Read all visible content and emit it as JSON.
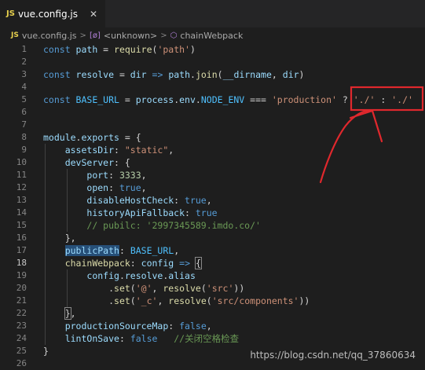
{
  "tab": {
    "badge": "JS",
    "filename": "vue.config.js",
    "close_glyph": "✕"
  },
  "breadcrumb": {
    "file_badge": "JS",
    "file": "vue.config.js",
    "sep1": ">",
    "unknown_icon": "[ø]",
    "unknown": "<unknown>",
    "sep2": ">",
    "symbol_icon": "⬡",
    "symbol": "chainWebpack"
  },
  "editor": {
    "active_line": 18,
    "lines": [
      {
        "n": "1",
        "t": [
          [
            "kw",
            "const "
          ],
          [
            "vr",
            "path"
          ],
          [
            "pl",
            " = "
          ],
          [
            "fn",
            "require"
          ],
          [
            "pl",
            "("
          ],
          [
            "st",
            "'path'"
          ],
          [
            "pl",
            ")"
          ]
        ]
      },
      {
        "n": "2",
        "t": []
      },
      {
        "n": "3",
        "t": [
          [
            "kw",
            "const "
          ],
          [
            "vr",
            "resolve"
          ],
          [
            "pl",
            " = "
          ],
          [
            "vr",
            "dir"
          ],
          [
            "pl",
            " "
          ],
          [
            "kw",
            "=>"
          ],
          [
            "pl",
            " "
          ],
          [
            "vr",
            "path"
          ],
          [
            "pl",
            "."
          ],
          [
            "fn",
            "join"
          ],
          [
            "pl",
            "("
          ],
          [
            "vr",
            "__dirname"
          ],
          [
            "pl",
            ", "
          ],
          [
            "vr",
            "dir"
          ],
          [
            "pl",
            ")"
          ]
        ]
      },
      {
        "n": "4",
        "t": []
      },
      {
        "n": "5",
        "t": [
          [
            "kw",
            "const "
          ],
          [
            "cn",
            "BASE_URL"
          ],
          [
            "pl",
            " = "
          ],
          [
            "vr",
            "process"
          ],
          [
            "pl",
            "."
          ],
          [
            "vr",
            "env"
          ],
          [
            "pl",
            "."
          ],
          [
            "cn",
            "NODE_ENV"
          ],
          [
            "pl",
            " === "
          ],
          [
            "st",
            "'production'"
          ],
          [
            "pl",
            " ? "
          ],
          [
            "st",
            "'./'"
          ],
          [
            "pl",
            " : "
          ],
          [
            "st",
            "'./'"
          ]
        ]
      },
      {
        "n": "6",
        "t": []
      },
      {
        "n": "7",
        "t": []
      },
      {
        "n": "8",
        "t": [
          [
            "vr",
            "module"
          ],
          [
            "pl",
            "."
          ],
          [
            "vr",
            "exports"
          ],
          [
            "pl",
            " = {"
          ]
        ]
      },
      {
        "n": "9",
        "t": [
          [
            "pl",
            "    "
          ],
          [
            "vr",
            "assetsDir"
          ],
          [
            "pl",
            ": "
          ],
          [
            "st",
            "\"static\""
          ],
          [
            "pl",
            ","
          ]
        ]
      },
      {
        "n": "10",
        "t": [
          [
            "pl",
            "    "
          ],
          [
            "vr",
            "devServer"
          ],
          [
            "pl",
            ": {"
          ]
        ]
      },
      {
        "n": "11",
        "t": [
          [
            "pl",
            "        "
          ],
          [
            "vr",
            "port"
          ],
          [
            "pl",
            ": "
          ],
          [
            "nm",
            "3333"
          ],
          [
            "pl",
            ","
          ]
        ]
      },
      {
        "n": "12",
        "t": [
          [
            "pl",
            "        "
          ],
          [
            "vr",
            "open"
          ],
          [
            "pl",
            ": "
          ],
          [
            "kw",
            "true"
          ],
          [
            "pl",
            ","
          ]
        ]
      },
      {
        "n": "13",
        "t": [
          [
            "pl",
            "        "
          ],
          [
            "vr",
            "disableHostCheck"
          ],
          [
            "pl",
            ": "
          ],
          [
            "kw",
            "true"
          ],
          [
            "pl",
            ","
          ]
        ]
      },
      {
        "n": "14",
        "t": [
          [
            "pl",
            "        "
          ],
          [
            "vr",
            "historyApiFallback"
          ],
          [
            "pl",
            ": "
          ],
          [
            "kw",
            "true"
          ]
        ]
      },
      {
        "n": "15",
        "t": [
          [
            "pl",
            "        "
          ],
          [
            "cm",
            "// pubilc: '2997345589.imdo.co/'"
          ]
        ]
      },
      {
        "n": "16",
        "t": [
          [
            "pl",
            "    },"
          ]
        ]
      },
      {
        "n": "17",
        "t": [
          [
            "pl",
            "    "
          ],
          [
            "vr hl",
            "publicPath"
          ],
          [
            "pl",
            ": "
          ],
          [
            "cn",
            "BASE_URL"
          ],
          [
            "pl",
            ","
          ]
        ]
      },
      {
        "n": "18",
        "t": [
          [
            "pl",
            "    "
          ],
          [
            "fn",
            "chainWebpack"
          ],
          [
            "pl",
            ": "
          ],
          [
            "vr",
            "config"
          ],
          [
            "pl",
            " "
          ],
          [
            "kw",
            "=>"
          ],
          [
            "pl",
            " "
          ],
          [
            "pl br",
            "{"
          ]
        ]
      },
      {
        "n": "19",
        "t": [
          [
            "pl",
            "        "
          ],
          [
            "vr",
            "config"
          ],
          [
            "pl",
            "."
          ],
          [
            "vr",
            "resolve"
          ],
          [
            "pl",
            "."
          ],
          [
            "vr",
            "alias"
          ]
        ]
      },
      {
        "n": "20",
        "t": [
          [
            "pl",
            "            ."
          ],
          [
            "fn",
            "set"
          ],
          [
            "pl",
            "("
          ],
          [
            "st",
            "'@'"
          ],
          [
            "pl",
            ", "
          ],
          [
            "fn",
            "resolve"
          ],
          [
            "pl",
            "("
          ],
          [
            "st",
            "'src'"
          ],
          [
            "pl",
            "))"
          ]
        ]
      },
      {
        "n": "21",
        "t": [
          [
            "pl",
            "            ."
          ],
          [
            "fn",
            "set"
          ],
          [
            "pl",
            "("
          ],
          [
            "st",
            "'_c'"
          ],
          [
            "pl",
            ", "
          ],
          [
            "fn",
            "resolve"
          ],
          [
            "pl",
            "("
          ],
          [
            "st",
            "'src/components'"
          ],
          [
            "pl",
            "))"
          ]
        ]
      },
      {
        "n": "22",
        "t": [
          [
            "pl",
            "    "
          ],
          [
            "pl br",
            "}"
          ],
          [
            "pl",
            ","
          ]
        ]
      },
      {
        "n": "23",
        "t": [
          [
            "pl",
            "    "
          ],
          [
            "vr",
            "productionSourceMap"
          ],
          [
            "pl",
            ": "
          ],
          [
            "kw",
            "false"
          ],
          [
            "pl",
            ","
          ]
        ]
      },
      {
        "n": "24",
        "t": [
          [
            "pl",
            "    "
          ],
          [
            "vr",
            "lintOnSave"
          ],
          [
            "pl",
            ": "
          ],
          [
            "kw",
            "false"
          ],
          [
            "pl",
            "   "
          ],
          [
            "cm",
            "//关闭空格检查"
          ]
        ]
      },
      {
        "n": "25",
        "t": [
          [
            "pl",
            "}"
          ]
        ]
      },
      {
        "n": "26",
        "t": []
      }
    ]
  },
  "colors": {
    "annotation": "#e0282d"
  },
  "watermark": "https://blog.csdn.net/qq_37860634"
}
